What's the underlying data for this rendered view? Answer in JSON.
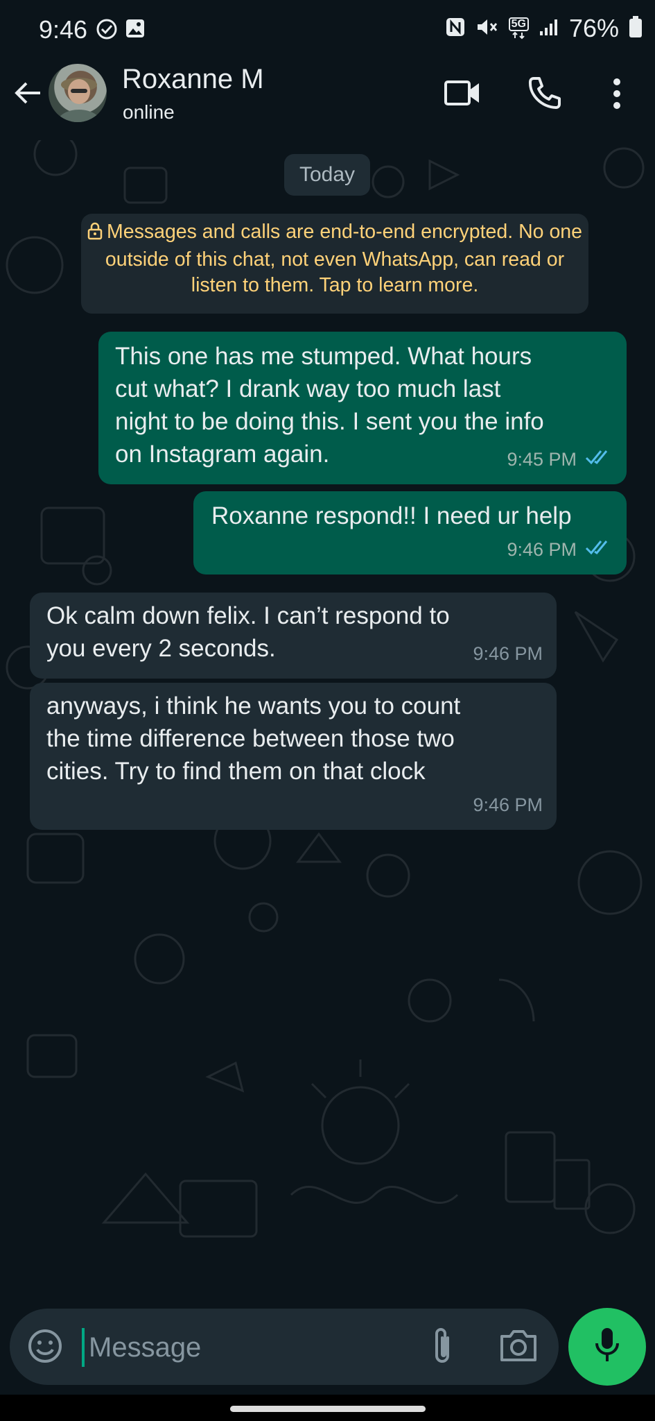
{
  "status_bar": {
    "time": "9:46",
    "battery_percent": "76%",
    "network": "5G",
    "icons": [
      "check-circle-icon",
      "gallery-icon",
      "nfc-icon",
      "mute-icon",
      "signal-icon",
      "battery-icon"
    ]
  },
  "header": {
    "contact_name": "Roxanne M",
    "status": "online",
    "icons": [
      "back-arrow-icon",
      "video-call-icon",
      "voice-call-icon",
      "more-options-icon"
    ]
  },
  "chat": {
    "date_label": "Today",
    "encryption_notice": "Messages and calls are end-to-end encrypted. No one outside of this chat, not even WhatsApp, can read or listen to them. Tap to learn more.",
    "messages": [
      {
        "direction": "outgoing",
        "text": "This one has me stumped. What hours\ncut what? I drank way too much last\nnight to be doing this. I sent you the info\non Instagram again.",
        "time": "9:45 PM",
        "status": "read"
      },
      {
        "direction": "outgoing",
        "text": "Roxanne respond!! I need ur help",
        "time": "9:46 PM",
        "status": "read"
      },
      {
        "direction": "incoming",
        "text": "Ok calm down felix. I can’t respond to\nyou every 2 seconds.",
        "time": "9:46 PM"
      },
      {
        "direction": "incoming",
        "text": "anyways, i think he wants you to count\nthe time difference between those two\ncities. Try to find them on that clock",
        "time": "9:46 PM"
      }
    ]
  },
  "composer": {
    "placeholder": "Message",
    "value": ""
  },
  "colors": {
    "background": "#0b141a",
    "outgoing_bubble": "#005c4b",
    "incoming_bubble": "#1f2c34",
    "accent_green": "#21c063",
    "read_tick": "#53bdeb",
    "encryption_text": "#ffd279"
  }
}
